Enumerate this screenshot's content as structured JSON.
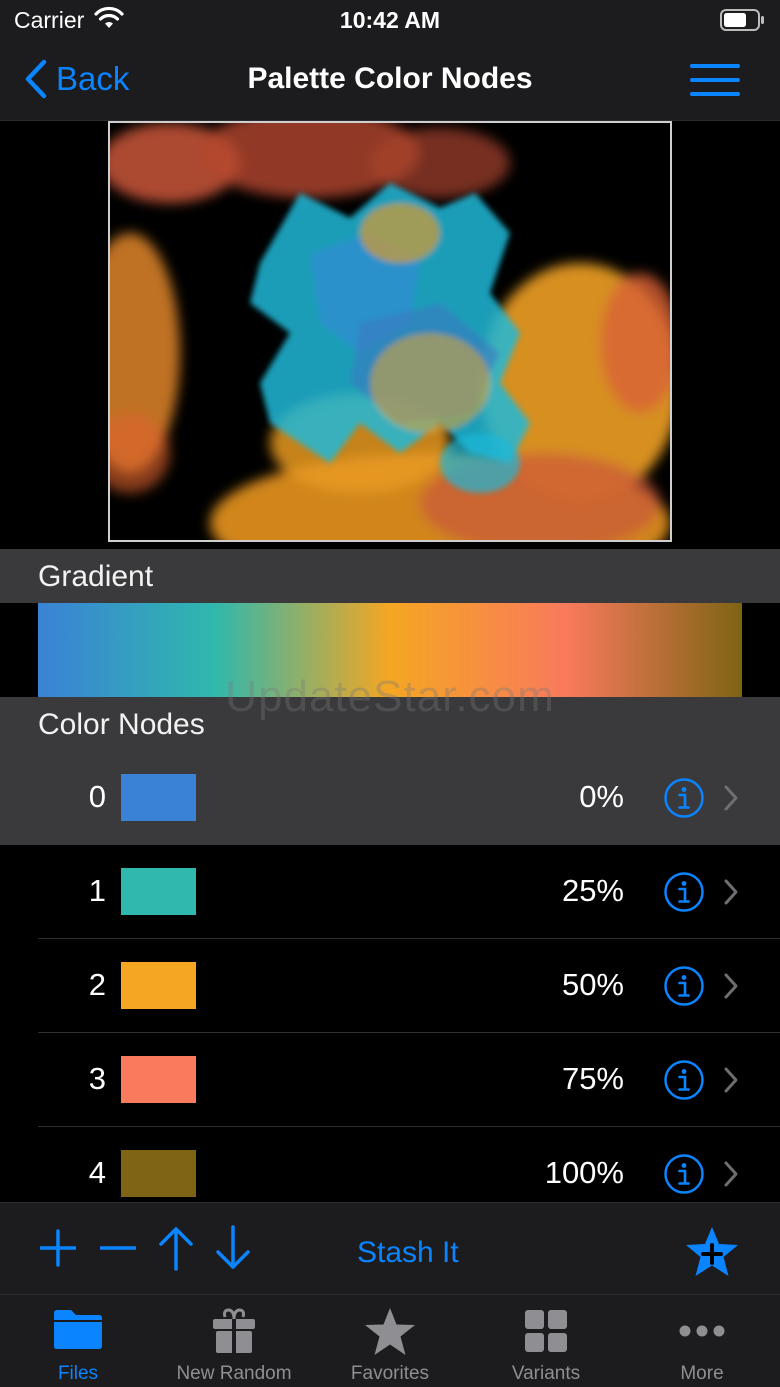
{
  "status": {
    "carrier": "Carrier",
    "time": "10:42 AM"
  },
  "nav": {
    "back_label": "Back",
    "title": "Palette Color Nodes"
  },
  "sections": {
    "gradient": "Gradient",
    "color_nodes": "Color Nodes"
  },
  "watermark": "UpdateStar.com",
  "gradient_stops": [
    {
      "color": "#3a82d6",
      "position": "0%"
    },
    {
      "color": "#2fb8ad",
      "position": "25%"
    },
    {
      "color": "#f5a623",
      "position": "50%"
    },
    {
      "color": "#f97a5c",
      "position": "75%"
    },
    {
      "color": "#7e6414",
      "position": "100%"
    }
  ],
  "nodes": [
    {
      "index": "0",
      "color": "#3a82d6",
      "percent": "0%",
      "selected": true
    },
    {
      "index": "1",
      "color": "#2fb8ad",
      "percent": "25%",
      "selected": false
    },
    {
      "index": "2",
      "color": "#f5a623",
      "percent": "50%",
      "selected": false
    },
    {
      "index": "3",
      "color": "#f97a5c",
      "percent": "75%",
      "selected": false
    },
    {
      "index": "4",
      "color": "#7e6414",
      "percent": "100%",
      "selected": false
    }
  ],
  "toolbar": {
    "add_icon": "plus-icon",
    "remove_icon": "minus-icon",
    "up_icon": "arrow-up-icon",
    "down_icon": "arrow-down-icon",
    "stash_label": "Stash It",
    "favorite_icon": "star-plus-icon"
  },
  "tabs": [
    {
      "label": "Files",
      "icon": "folder-icon",
      "active": true
    },
    {
      "label": "New Random",
      "icon": "gift-icon",
      "active": false
    },
    {
      "label": "Favorites",
      "icon": "star-icon",
      "active": false
    },
    {
      "label": "Variants",
      "icon": "grid-icon",
      "active": false
    },
    {
      "label": "More",
      "icon": "more-icon",
      "active": false
    }
  ],
  "colors": {
    "accent": "#0a84ff",
    "bar": "#1c1c1e",
    "header": "#3a3a3c"
  }
}
